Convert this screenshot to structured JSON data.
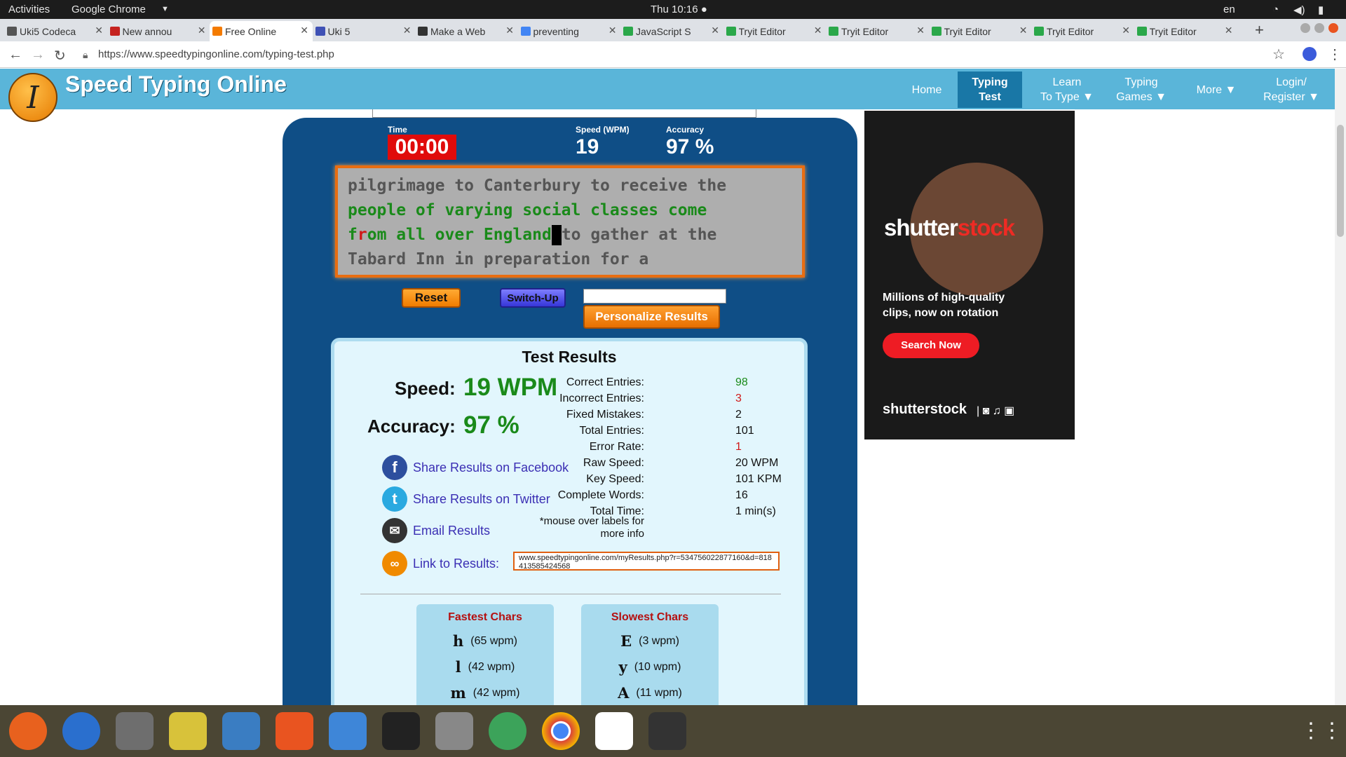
{
  "os_bar": {
    "activities": "Activities",
    "app": "Google Chrome",
    "clock": "Thu 10:16 ●",
    "lang": "en"
  },
  "tabs": [
    {
      "label": "Uki5 Codeca",
      "fav": "#555"
    },
    {
      "label": "New annou",
      "fav": "#c5221f"
    },
    {
      "label": "Free Online",
      "fav": "#f47b00"
    },
    {
      "label": "Uki 5",
      "fav": "#3f51b5"
    },
    {
      "label": "Make a Web",
      "fav": "#333"
    },
    {
      "label": "preventing",
      "fav": "#4285f4"
    },
    {
      "label": "JavaScript S",
      "fav": "#2ba84a"
    },
    {
      "label": "Tryit Editor",
      "fav": "#2ba84a"
    },
    {
      "label": "Tryit Editor",
      "fav": "#2ba84a"
    },
    {
      "label": "Tryit Editor",
      "fav": "#2ba84a"
    },
    {
      "label": "Tryit Editor",
      "fav": "#2ba84a"
    },
    {
      "label": "Tryit Editor",
      "fav": "#2ba84a"
    }
  ],
  "address": {
    "url": "https://www.speedtypingonline.com/typing-test.php"
  },
  "site": {
    "logo_letter": "I",
    "name": "Speed Typing Online",
    "nav": [
      {
        "l1": "Home",
        "l2": ""
      },
      {
        "l1": "Typing",
        "l2": "Test"
      },
      {
        "l1": "Learn",
        "l2": "To Type ▼"
      },
      {
        "l1": "Typing",
        "l2": "Games ▼"
      },
      {
        "l1": "More ▼",
        "l2": ""
      },
      {
        "l1": "Login/",
        "l2": "Register ▼"
      }
    ]
  },
  "stats": {
    "time_label": "Time",
    "time_value": "00:00",
    "speed_label": "Speed (WPM)",
    "speed_value": "19",
    "acc_label": "Accuracy",
    "acc_value": "97 %"
  },
  "typing": {
    "line1": "pilgrimage to Canterbury to receive the",
    "line2": "people of varying social classes come",
    "line3_f": "f",
    "line3_r": "r",
    "line3_green": "om all over England",
    "line3_rest": "to gather at the",
    "line4": "Tabard Inn in preparation for a"
  },
  "controls": {
    "reset": "Reset",
    "switchup": "Switch-Up",
    "name_value": "",
    "personalize": "Personalize Results"
  },
  "results": {
    "title": "Test Results",
    "speed_label": "Speed:",
    "speed_value": "19 WPM",
    "acc_label": "Accuracy:",
    "acc_value": "97 %",
    "rows": [
      {
        "label": "Correct Entries:",
        "value": "98",
        "color": "#1a8a1a"
      },
      {
        "label": "Incorrect Entries:",
        "value": "3",
        "color": "#d01818"
      },
      {
        "label": "Fixed Mistakes:",
        "value": "2",
        "color": "#111"
      },
      {
        "label": "Total Entries:",
        "value": "101",
        "color": "#111"
      },
      {
        "label": "Error Rate:",
        "value": "1",
        "color": "#d01818"
      },
      {
        "label": "Raw Speed:",
        "value": "20 WPM",
        "color": "#111"
      },
      {
        "label": "Key Speed:",
        "value": "101 KPM",
        "color": "#111"
      },
      {
        "label": "Complete Words:",
        "value": "16",
        "color": "#111"
      },
      {
        "label": "Total Time:",
        "value": "1 min(s)",
        "color": "#111"
      }
    ],
    "note1": "*mouse over labels for",
    "note2": "more info",
    "share_fb": "Share Results on Facebook",
    "share_tw": "Share Results on Twitter",
    "email": "Email Results",
    "link_label": "Link to Results:",
    "link_value": "www.speedtypingonline.com/myResults.php?r=534756022877160&d=818413585424568",
    "fastest_title": "Fastest Chars",
    "fastest": [
      {
        "c": "h",
        "v": "(65 wpm)"
      },
      {
        "c": "l",
        "v": "(42 wpm)"
      },
      {
        "c": "m",
        "v": "(42 wpm)"
      }
    ],
    "slowest_title": "Slowest Chars",
    "slowest": [
      {
        "c": "E",
        "v": "(3 wpm)"
      },
      {
        "c": "y",
        "v": "(10 wpm)"
      },
      {
        "c": "A",
        "v": "(11 wpm)"
      }
    ]
  },
  "ad": {
    "brand_a": "shutter",
    "brand_b": "st",
    "brand_c": "ck",
    "line1": "Millions of high-quality",
    "line2": "clips, now on rotation",
    "cta": "Search Now",
    "footer": "shutterstock"
  },
  "dock": [
    "firefox-icon",
    "thunderbird-icon",
    "files-icon",
    "rhythmbox-icon",
    "libreoffice-impress-icon",
    "software-center-icon",
    "help-icon",
    "amazon-icon",
    "camera-icon",
    "atom-icon",
    "chrome-icon",
    "slack-icon",
    "updater-icon",
    "app-grid-icon"
  ]
}
